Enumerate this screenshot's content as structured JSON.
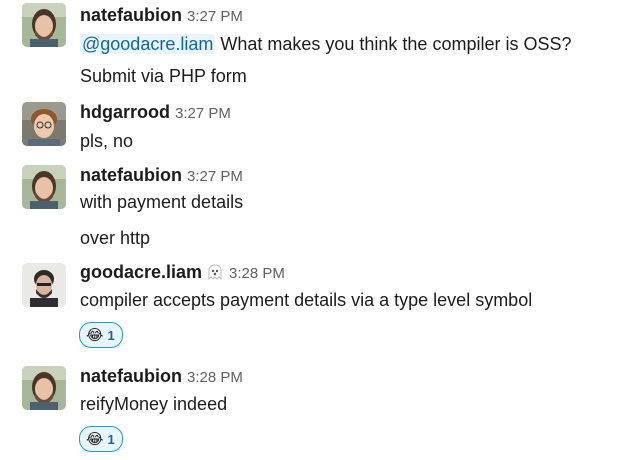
{
  "messages": [
    {
      "author": "natefaubion",
      "time": "3:27 PM",
      "lines": [
        {
          "mention": "@goodacre.liam",
          "text": " What makes you think the compiler is OSS?"
        },
        {
          "text": "Submit via PHP form"
        }
      ]
    },
    {
      "author": "hdgarrood",
      "time": "3:27 PM",
      "lines": [
        {
          "text": "pls, no"
        }
      ]
    },
    {
      "author": "natefaubion",
      "time": "3:27 PM",
      "lines": [
        {
          "text": "with payment details"
        },
        {
          "text": "over http"
        }
      ]
    },
    {
      "author": "goodacre.liam",
      "status_icon": "ghost-icon",
      "time": "3:28 PM",
      "lines": [
        {
          "text": "compiler accepts payment details via a type level symbol"
        }
      ],
      "reaction": {
        "emoji": "😂",
        "count": "1"
      }
    },
    {
      "author": "natefaubion",
      "time": "3:28 PM",
      "lines": [
        {
          "text": "reifyMoney indeed"
        }
      ],
      "reaction": {
        "emoji": "😂",
        "count": "1"
      }
    }
  ],
  "colors": {
    "link": "#1264a3",
    "reaction_border": "#1d9bd1",
    "reaction_bg": "#e8f5fa",
    "timestamp": "#616061"
  }
}
